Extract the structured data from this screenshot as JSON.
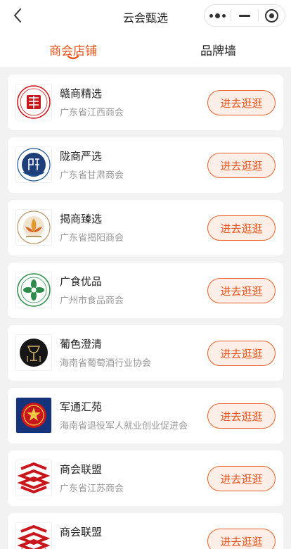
{
  "nav": {
    "title": "云会甄选",
    "back_icon": "chevron-left-icon",
    "capsule": {
      "more_icon": "more-dots-icon",
      "minimize_icon": "minus-icon",
      "close_icon": "target-circle-icon"
    }
  },
  "tabs": [
    {
      "label": "商会店铺",
      "active": true
    },
    {
      "label": "品牌墙",
      "active": false
    }
  ],
  "colors": {
    "accent": "#e8531c",
    "button_bg": "#fdeee7",
    "page_bg": "#f2f2f2",
    "subtext": "#999999"
  },
  "items": [
    {
      "name": "赣商精选",
      "org": "广东省江西商会",
      "button": "进去逛逛",
      "logo": "jiangxi-chamber-logo-icon"
    },
    {
      "name": "陇商严选",
      "org": "广东省甘肃商会",
      "button": "进去逛逛",
      "logo": "gansu-chamber-logo-icon"
    },
    {
      "name": "揭商臻选",
      "org": "广东省揭阳商会",
      "button": "进去逛逛",
      "logo": "jieyang-chamber-logo-icon"
    },
    {
      "name": "广食优品",
      "org": "广州市食品商会",
      "button": "进去逛逛",
      "logo": "guangzhou-food-chamber-logo-icon"
    },
    {
      "name": "葡色澄清",
      "org": "海南省葡萄酒行业协会",
      "button": "进去逛逛",
      "logo": "hainan-wine-association-logo-icon"
    },
    {
      "name": "军通汇苑",
      "org": "海南省退役军人就业创业促进会",
      "button": "进去逛逛",
      "logo": "veterans-association-logo-icon"
    },
    {
      "name": "商会联盟",
      "org": "广东省江苏商会",
      "button": "进去逛逛",
      "logo": "jiangsu-chamber-logo-icon"
    },
    {
      "name": "商会联盟",
      "org": "",
      "button": "进去逛逛",
      "logo": "jiangsu-chamber-logo-icon"
    }
  ]
}
